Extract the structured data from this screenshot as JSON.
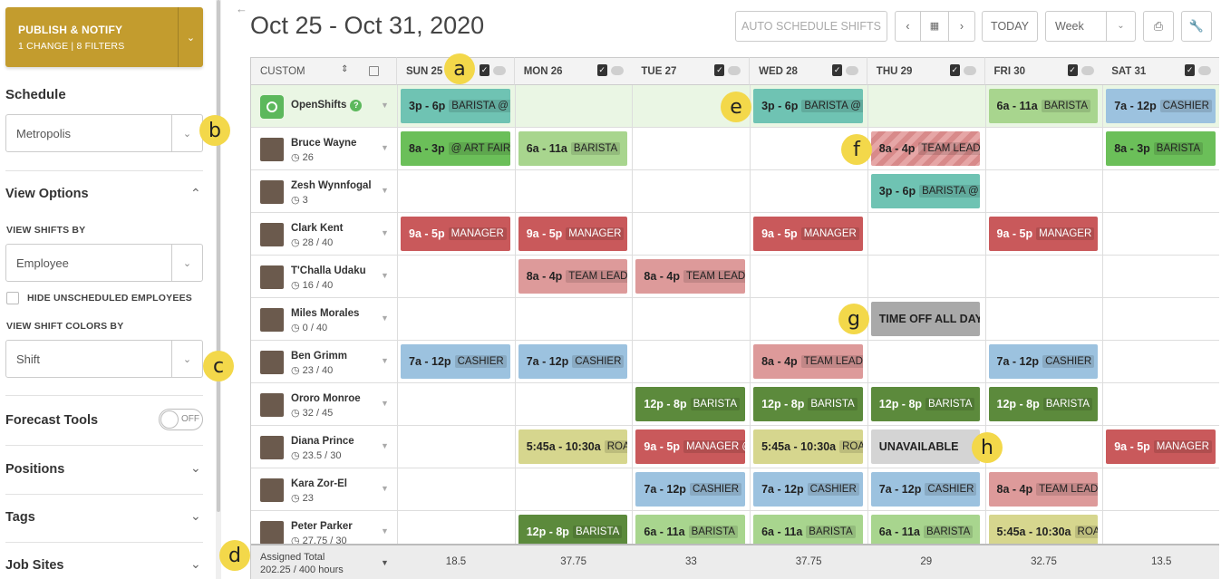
{
  "sidebar": {
    "publish_title": "PUBLISH & NOTIFY",
    "publish_sub": "1 CHANGE | 8 FILTERS",
    "schedule_label": "Schedule",
    "schedule_value": "Metropolis",
    "view_options_label": "View Options",
    "view_shifts_by_label": "VIEW SHIFTS BY",
    "view_shifts_by_value": "Employee",
    "hide_unscheduled_label": "HIDE UNSCHEDULED EMPLOYEES",
    "view_colors_by_label": "VIEW SHIFT COLORS BY",
    "view_colors_by_value": "Shift",
    "forecast_label": "Forecast Tools",
    "forecast_toggle": "OFF",
    "positions_label": "Positions",
    "tags_label": "Tags",
    "job_sites_label": "Job Sites"
  },
  "header": {
    "title": "Oct 25 - Oct 31, 2020",
    "auto_schedule": "AUTO SCHEDULE SHIFTS",
    "today": "TODAY",
    "view_mode": "Week"
  },
  "grid": {
    "sort_label": "CUSTOM",
    "days": [
      "SUN 25",
      "MON 26",
      "TUE 27",
      "WED 28",
      "THU 29",
      "FRI 30",
      "SAT 31"
    ],
    "rows": [
      {
        "name": "OpenShifts",
        "hours": ""
      },
      {
        "name": "Bruce Wayne",
        "hours": "26"
      },
      {
        "name": "Zesh Wynnfogal",
        "hours": "3"
      },
      {
        "name": "Clark Kent",
        "hours": "28 / 40"
      },
      {
        "name": "T'Challa Udaku",
        "hours": "16 / 40"
      },
      {
        "name": "Miles Morales",
        "hours": "0 / 40"
      },
      {
        "name": "Ben Grimm",
        "hours": "23 / 40"
      },
      {
        "name": "Ororo Monroe",
        "hours": "32 / 45"
      },
      {
        "name": "Diana Prince",
        "hours": "23.5 / 30"
      },
      {
        "name": "Kara Zor-El",
        "hours": "23"
      },
      {
        "name": "Peter Parker",
        "hours": "27.75 / 30"
      }
    ],
    "shifts": [
      {
        "row": 0,
        "day": 0,
        "time": "3p - 6p",
        "tag": "BARISTA @ A",
        "color": "#6fc3b3"
      },
      {
        "row": 0,
        "day": 3,
        "time": "3p - 6p",
        "tag": "BARISTA @ A",
        "color": "#6fc3b3"
      },
      {
        "row": 0,
        "day": 5,
        "time": "6a - 11a",
        "tag": "BARISTA",
        "color": "#a8d58e"
      },
      {
        "row": 0,
        "day": 6,
        "time": "7a - 12p",
        "tag": "CASHIER",
        "color": "#9cc2df"
      },
      {
        "row": 1,
        "day": 0,
        "time": "8a - 3p",
        "tag": "@ ART FAIR E",
        "color": "#6bbf59"
      },
      {
        "row": 1,
        "day": 1,
        "time": "6a - 11a",
        "tag": "BARISTA",
        "color": "#a8d58e"
      },
      {
        "row": 1,
        "day": 4,
        "time": "8a - 4p",
        "tag": "TEAM LEAD",
        "color": "#e6a6a6",
        "striped": true
      },
      {
        "row": 1,
        "day": 6,
        "time": "8a - 3p",
        "tag": "BARISTA",
        "color": "#6bbf59"
      },
      {
        "row": 2,
        "day": 4,
        "time": "3p - 6p",
        "tag": "BARISTA @ A",
        "color": "#6fc3b3"
      },
      {
        "row": 3,
        "day": 0,
        "time": "9a - 5p",
        "tag": "MANAGER",
        "color": "#c9595b",
        "light": true
      },
      {
        "row": 3,
        "day": 1,
        "time": "9a - 5p",
        "tag": "MANAGER",
        "color": "#c9595b",
        "light": true
      },
      {
        "row": 3,
        "day": 3,
        "time": "9a - 5p",
        "tag": "MANAGER",
        "color": "#c9595b",
        "light": true
      },
      {
        "row": 3,
        "day": 5,
        "time": "9a - 5p",
        "tag": "MANAGER",
        "color": "#c9595b",
        "light": true
      },
      {
        "row": 4,
        "day": 1,
        "time": "8a - 4p",
        "tag": "TEAM LEAD",
        "color": "#dd9a9a"
      },
      {
        "row": 4,
        "day": 2,
        "time": "8a - 4p",
        "tag": "TEAM LEAD",
        "color": "#dd9a9a"
      },
      {
        "row": 5,
        "day": 4,
        "time": "TIME OFF ALL DAY",
        "tag": "",
        "color": "#a9a9a9"
      },
      {
        "row": 6,
        "day": 0,
        "time": "7a - 12p",
        "tag": "CASHIER",
        "color": "#9cc2df"
      },
      {
        "row": 6,
        "day": 1,
        "time": "7a - 12p",
        "tag": "CASHIER",
        "color": "#9cc2df"
      },
      {
        "row": 6,
        "day": 3,
        "time": "8a - 4p",
        "tag": "TEAM LEAD",
        "color": "#dd9a9a"
      },
      {
        "row": 6,
        "day": 5,
        "time": "7a - 12p",
        "tag": "CASHIER",
        "color": "#9cc2df"
      },
      {
        "row": 7,
        "day": 2,
        "time": "12p - 8p",
        "tag": "BARISTA",
        "color": "#5c8a3c",
        "light": true
      },
      {
        "row": 7,
        "day": 3,
        "time": "12p - 8p",
        "tag": "BARISTA",
        "color": "#5c8a3c",
        "light": true
      },
      {
        "row": 7,
        "day": 4,
        "time": "12p - 8p",
        "tag": "BARISTA",
        "color": "#5c8a3c",
        "light": true
      },
      {
        "row": 7,
        "day": 5,
        "time": "12p - 8p",
        "tag": "BARISTA",
        "color": "#5c8a3c",
        "light": true
      },
      {
        "row": 8,
        "day": 1,
        "time": "5:45a - 10:30a",
        "tag": "ROAS",
        "color": "#d6d68e"
      },
      {
        "row": 8,
        "day": 2,
        "time": "9a - 5p",
        "tag": "MANAGER @",
        "color": "#c9595b",
        "light": true
      },
      {
        "row": 8,
        "day": 3,
        "time": "5:45a - 10:30a",
        "tag": "ROAS",
        "color": "#d6d68e"
      },
      {
        "row": 8,
        "day": 4,
        "time": "UNAVAILABLE",
        "tag": "",
        "color": "#d4d4d4"
      },
      {
        "row": 8,
        "day": 6,
        "time": "9a - 5p",
        "tag": "MANAGER",
        "color": "#c9595b",
        "light": true
      },
      {
        "row": 9,
        "day": 2,
        "time": "7a - 12p",
        "tag": "CASHIER",
        "color": "#9cc2df"
      },
      {
        "row": 9,
        "day": 3,
        "time": "7a - 12p",
        "tag": "CASHIER",
        "color": "#9cc2df"
      },
      {
        "row": 9,
        "day": 4,
        "time": "7a - 12p",
        "tag": "CASHIER",
        "color": "#9cc2df"
      },
      {
        "row": 9,
        "day": 5,
        "time": "8a - 4p",
        "tag": "TEAM LEAD",
        "color": "#dd9a9a"
      },
      {
        "row": 10,
        "day": 1,
        "time": "12p - 8p",
        "tag": "BARISTA",
        "color": "#5c8a3c",
        "light": true
      },
      {
        "row": 10,
        "day": 2,
        "time": "6a - 11a",
        "tag": "BARISTA",
        "color": "#a8d58e"
      },
      {
        "row": 10,
        "day": 3,
        "time": "6a - 11a",
        "tag": "BARISTA",
        "color": "#a8d58e"
      },
      {
        "row": 10,
        "day": 4,
        "time": "6a - 11a",
        "tag": "BARISTA",
        "color": "#a8d58e"
      },
      {
        "row": 10,
        "day": 5,
        "time": "5:45a - 10:30a",
        "tag": "ROAS",
        "color": "#d6d68e"
      }
    ],
    "footer_label_1": "Assigned Total",
    "footer_label_2": "202.25 / 400 hours",
    "totals": [
      "18.5",
      "37.75",
      "33",
      "37.75",
      "29",
      "32.75",
      "13.5"
    ]
  },
  "markers": [
    "a",
    "b",
    "c",
    "d",
    "e",
    "f",
    "g",
    "h"
  ]
}
